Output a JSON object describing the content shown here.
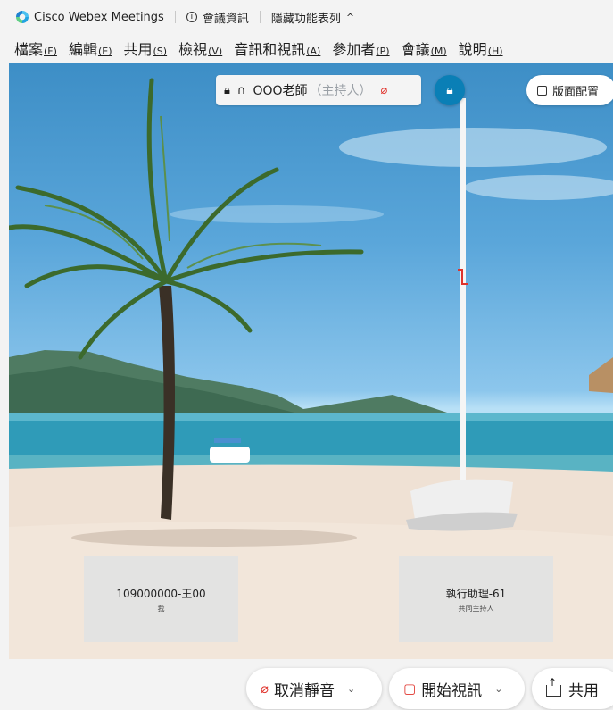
{
  "titlebar": {
    "app_title": "Cisco Webex Meetings",
    "meeting_info": "會議資訊",
    "hide_menu": "隱藏功能表列",
    "hide_menu_chevron": "^"
  },
  "menu": [
    {
      "label": "檔案",
      "key": "(F)"
    },
    {
      "label": "編輯",
      "key": "(E)"
    },
    {
      "label": "共用",
      "key": "(S)"
    },
    {
      "label": "檢視",
      "key": "(V)"
    },
    {
      "label": "音訊和視訊",
      "key": "(A)"
    },
    {
      "label": "參加者",
      "key": "(P)"
    },
    {
      "label": "會議",
      "key": "(M)"
    },
    {
      "label": "說明",
      "key": "(H)"
    }
  ],
  "host_chip": {
    "name": "OOO老師",
    "role": "（主持人）"
  },
  "layout_button": "版面配置",
  "tiles": [
    {
      "name": "109000000-王00",
      "sub": "我"
    },
    {
      "name": "執行助理-61",
      "sub": "共同主持人"
    }
  ],
  "controls": {
    "unmute": "取消靜音",
    "start_video": "開始視訊",
    "share": "共用"
  },
  "colors": {
    "accent": "#0a7fb6",
    "muted_red": "#e0332c"
  },
  "icons": [
    "app-logo-icon",
    "info-icon",
    "lock-icon",
    "headset-icon",
    "mic-muted-icon",
    "layout-icon",
    "chevron-down-icon",
    "video-off-icon",
    "share-icon"
  ]
}
